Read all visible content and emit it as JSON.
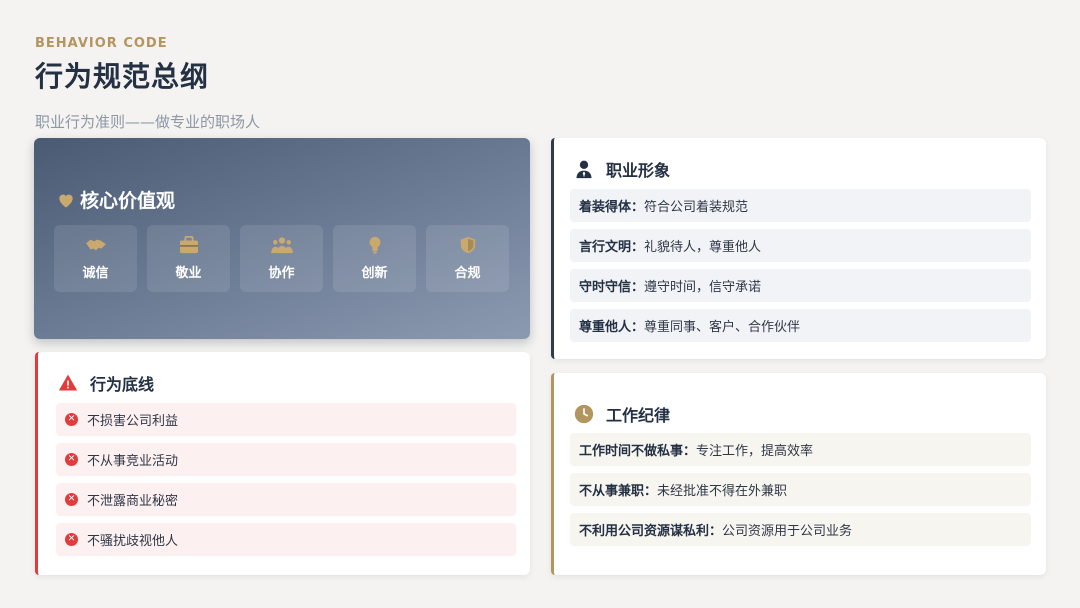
{
  "header": {
    "eyebrow": "BEHAVIOR CODE",
    "title": "行为规范总纲",
    "subtitle": "职业行为准则——做专业的职场人"
  },
  "core_values": {
    "title": "核心价值观",
    "icon": "heart-icon",
    "items": [
      {
        "label": "诚信",
        "icon": "handshake-icon"
      },
      {
        "label": "敬业",
        "icon": "briefcase-icon"
      },
      {
        "label": "协作",
        "icon": "team-icon"
      },
      {
        "label": "创新",
        "icon": "lightbulb-icon"
      },
      {
        "label": "合规",
        "icon": "shield-icon"
      }
    ]
  },
  "bottom_line": {
    "title": "行为底线",
    "icon": "warning-icon",
    "items": [
      "不损害公司利益",
      "不从事竞业活动",
      "不泄露商业秘密",
      "不骚扰歧视他人"
    ]
  },
  "professional_image": {
    "title": "职业形象",
    "icon": "user-icon",
    "items": [
      {
        "key": "着装得体：",
        "value": "符合公司着装规范"
      },
      {
        "key": "言行文明：",
        "value": "礼貌待人，尊重他人"
      },
      {
        "key": "守时守信：",
        "value": "遵守时间，信守承诺"
      },
      {
        "key": "尊重他人：",
        "value": "尊重同事、客户、合作伙伴"
      }
    ]
  },
  "work_discipline": {
    "title": "工作纪律",
    "icon": "clock-icon",
    "items": [
      {
        "key": "工作时间不做私事：",
        "value": "专注工作，提高效率"
      },
      {
        "key": "不从事兼职：",
        "value": "未经批准不得在外兼职"
      },
      {
        "key": "不利用公司资源谋私利：",
        "value": "公司资源用于公司业务"
      }
    ]
  },
  "colors": {
    "accent_gold": "#b3955f",
    "danger_red": "#e23b3b",
    "navy": "#243043"
  }
}
